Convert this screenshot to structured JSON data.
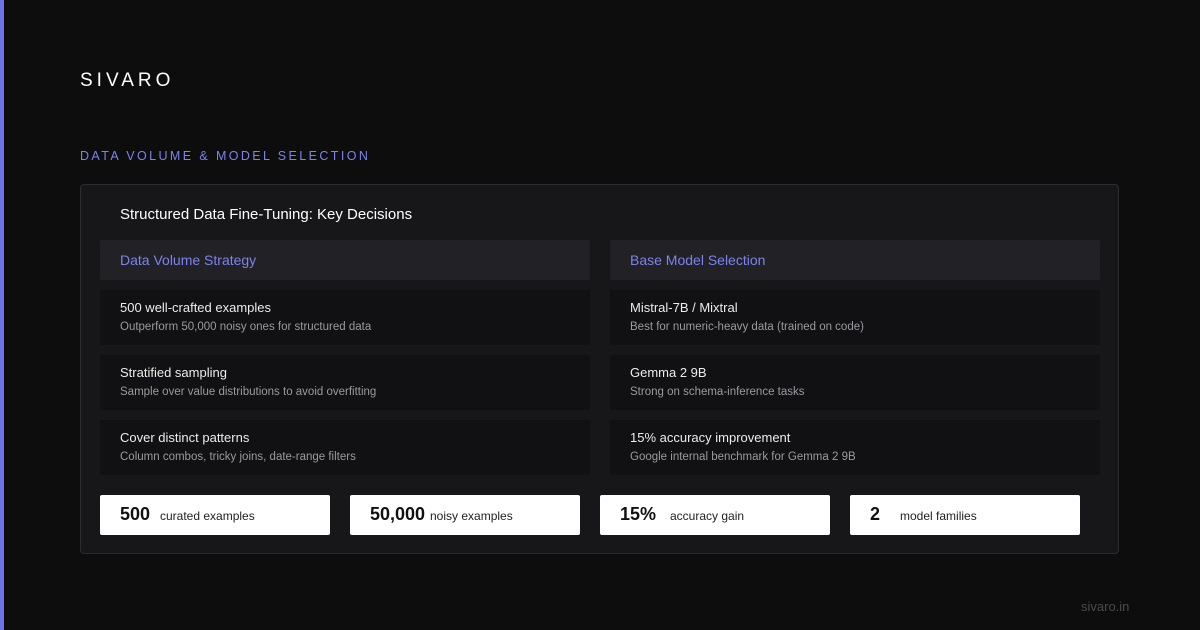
{
  "brand": "SIVARO",
  "section_label": "DATA VOLUME & MODEL SELECTION",
  "card": {
    "title": "Structured Data Fine-Tuning: Key Decisions",
    "left": {
      "header": "Data Volume Strategy",
      "items": [
        {
          "title": "500 well-crafted examples",
          "desc": "Outperform 50,000 noisy ones for structured data"
        },
        {
          "title": "Stratified sampling",
          "desc": "Sample over value distributions to avoid overfitting"
        },
        {
          "title": "Cover distinct patterns",
          "desc": "Column combos, tricky joins, date-range filters"
        }
      ]
    },
    "right": {
      "header": "Base Model Selection",
      "items": [
        {
          "title": "Mistral-7B / Mixtral",
          "desc": "Best for numeric-heavy data (trained on code)"
        },
        {
          "title": "Gemma 2 9B",
          "desc": "Strong on schema-inference tasks"
        },
        {
          "title": "15% accuracy improvement",
          "desc": "Google internal benchmark for Gemma 2 9B"
        }
      ]
    },
    "stats": [
      {
        "value": "500",
        "label": "curated examples"
      },
      {
        "value": "50,000",
        "label": "noisy examples"
      },
      {
        "value": "15%",
        "label": "accuracy gain"
      },
      {
        "value": "2",
        "label": "model families"
      }
    ]
  },
  "footer": "sivaro.in",
  "colors": {
    "background": "#0d0d0d",
    "accent": "#6b73e8",
    "accent_text": "#7b83ee",
    "card": "#17171a",
    "stat_card": "#ffffff"
  }
}
